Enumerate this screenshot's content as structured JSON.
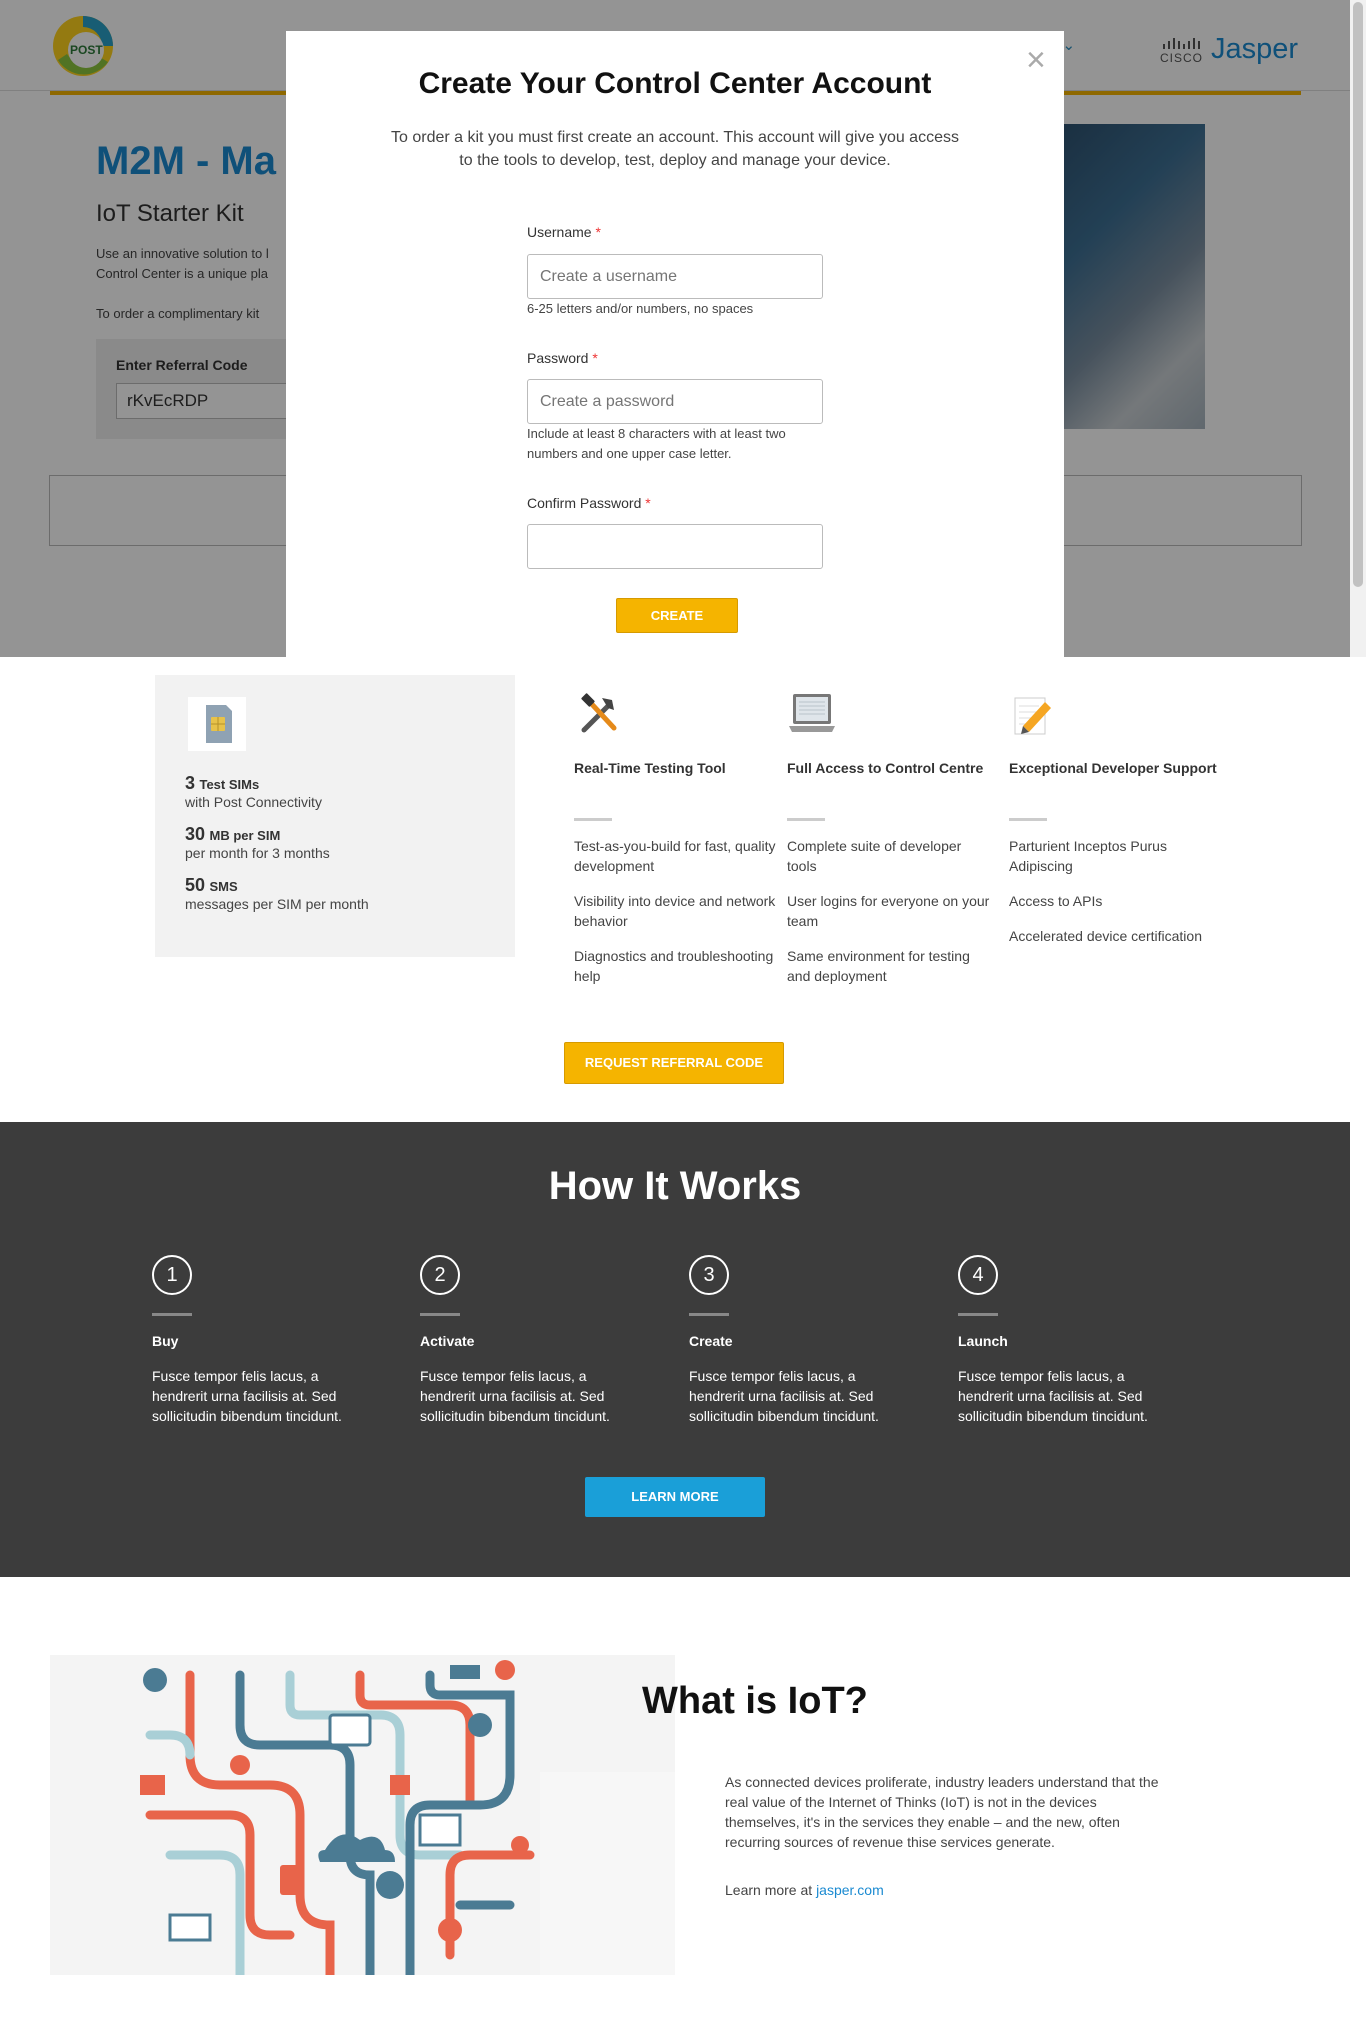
{
  "header": {
    "logo_text": "POST",
    "lang_label": "h",
    "partner_logo": {
      "cisco": "CISCO",
      "name": "Jasper"
    }
  },
  "hero": {
    "title": "M2M - Ma",
    "subtitle": "IoT Starter Kit",
    "desc_line1": "Use an innovative solution to l",
    "desc_line2": "Control Center is a unique pla",
    "order_text": "To order a complimentary kit",
    "referral_label": "Enter Referral Code",
    "referral_value": "rKvEcRDP"
  },
  "modal": {
    "title": "Create Your Control Center Account",
    "intro_line1": "To order a kit you must first create an account. This account will give you access",
    "intro_line2": "to the tools to develop, test, deploy and manage your device.",
    "username_label": "Username",
    "username_placeholder": "Create a username",
    "username_hint": "6-25 letters and/or numbers, no spaces",
    "password_label": "Password",
    "password_placeholder": "Create a password",
    "password_hint_line1": "Include at least 8 characters with at least two",
    "password_hint_line2": "numbers and one upper case letter.",
    "confirm_label": "Confirm Password",
    "required_mark": "*",
    "create_label": "CREATE",
    "close_label": "×"
  },
  "kit": {
    "items": [
      {
        "num": "3",
        "unit": "Test SIMs",
        "sub": "with Post Connectivity"
      },
      {
        "num": "30",
        "unit": "MB per SIM",
        "sub": "per month for 3 months"
      },
      {
        "num": "50",
        "unit": "SMS",
        "sub": "messages per SIM per month"
      }
    ]
  },
  "features": [
    {
      "title": "Real-Time Testing Tool",
      "items": [
        "Test-as-you-build for fast, quality development",
        "Visibility into device and network behavior",
        "Diagnostics and troubleshooting help"
      ]
    },
    {
      "title": "Full Access to Control Centre",
      "items": [
        "Complete suite of developer tools",
        "User logins for everyone on your team",
        "Same environment for testing and deployment"
      ]
    },
    {
      "title": "Exceptional Developer Support",
      "items": [
        "Parturient Inceptos Purus Adipiscing",
        "Access to APIs",
        "Accelerated device certification"
      ]
    }
  ],
  "request_button": "REQUEST REFERRAL CODE",
  "how": {
    "title": "How It Works",
    "steps": [
      {
        "num": "1",
        "title": "Buy",
        "desc": "Fusce tempor felis lacus, a hendrerit urna facilisis at. Sed sollicitudin bibendum tincidunt."
      },
      {
        "num": "2",
        "title": "Activate",
        "desc": "Fusce tempor felis lacus, a hendrerit urna facilisis at. Sed sollicitudin bibendum tincidunt."
      },
      {
        "num": "3",
        "title": "Create",
        "desc": "Fusce tempor felis lacus, a hendrerit urna facilisis at. Sed sollicitudin bibendum tincidunt."
      },
      {
        "num": "4",
        "title": "Launch",
        "desc": "Fusce tempor felis lacus, a hendrerit urna facilisis at. Sed sollicitudin bibendum tincidunt."
      }
    ],
    "button": "LEARN MORE"
  },
  "iot": {
    "title": "What is IoT?",
    "paragraph": "As connected devices proliferate, industry leaders understand that the real value of the Internet of Thinks (IoT) is not in the devices themselves, it's in the services they enable – and the new, often recurring sources of revenue thise services generate.",
    "learn_prefix": "Learn more at ",
    "learn_link": "jasper.com"
  },
  "colors": {
    "accent": "#f5b400",
    "brand_blue": "#1a8ad1",
    "dark_band": "#3c3c3c",
    "learn_button": "#1a9fd8"
  }
}
